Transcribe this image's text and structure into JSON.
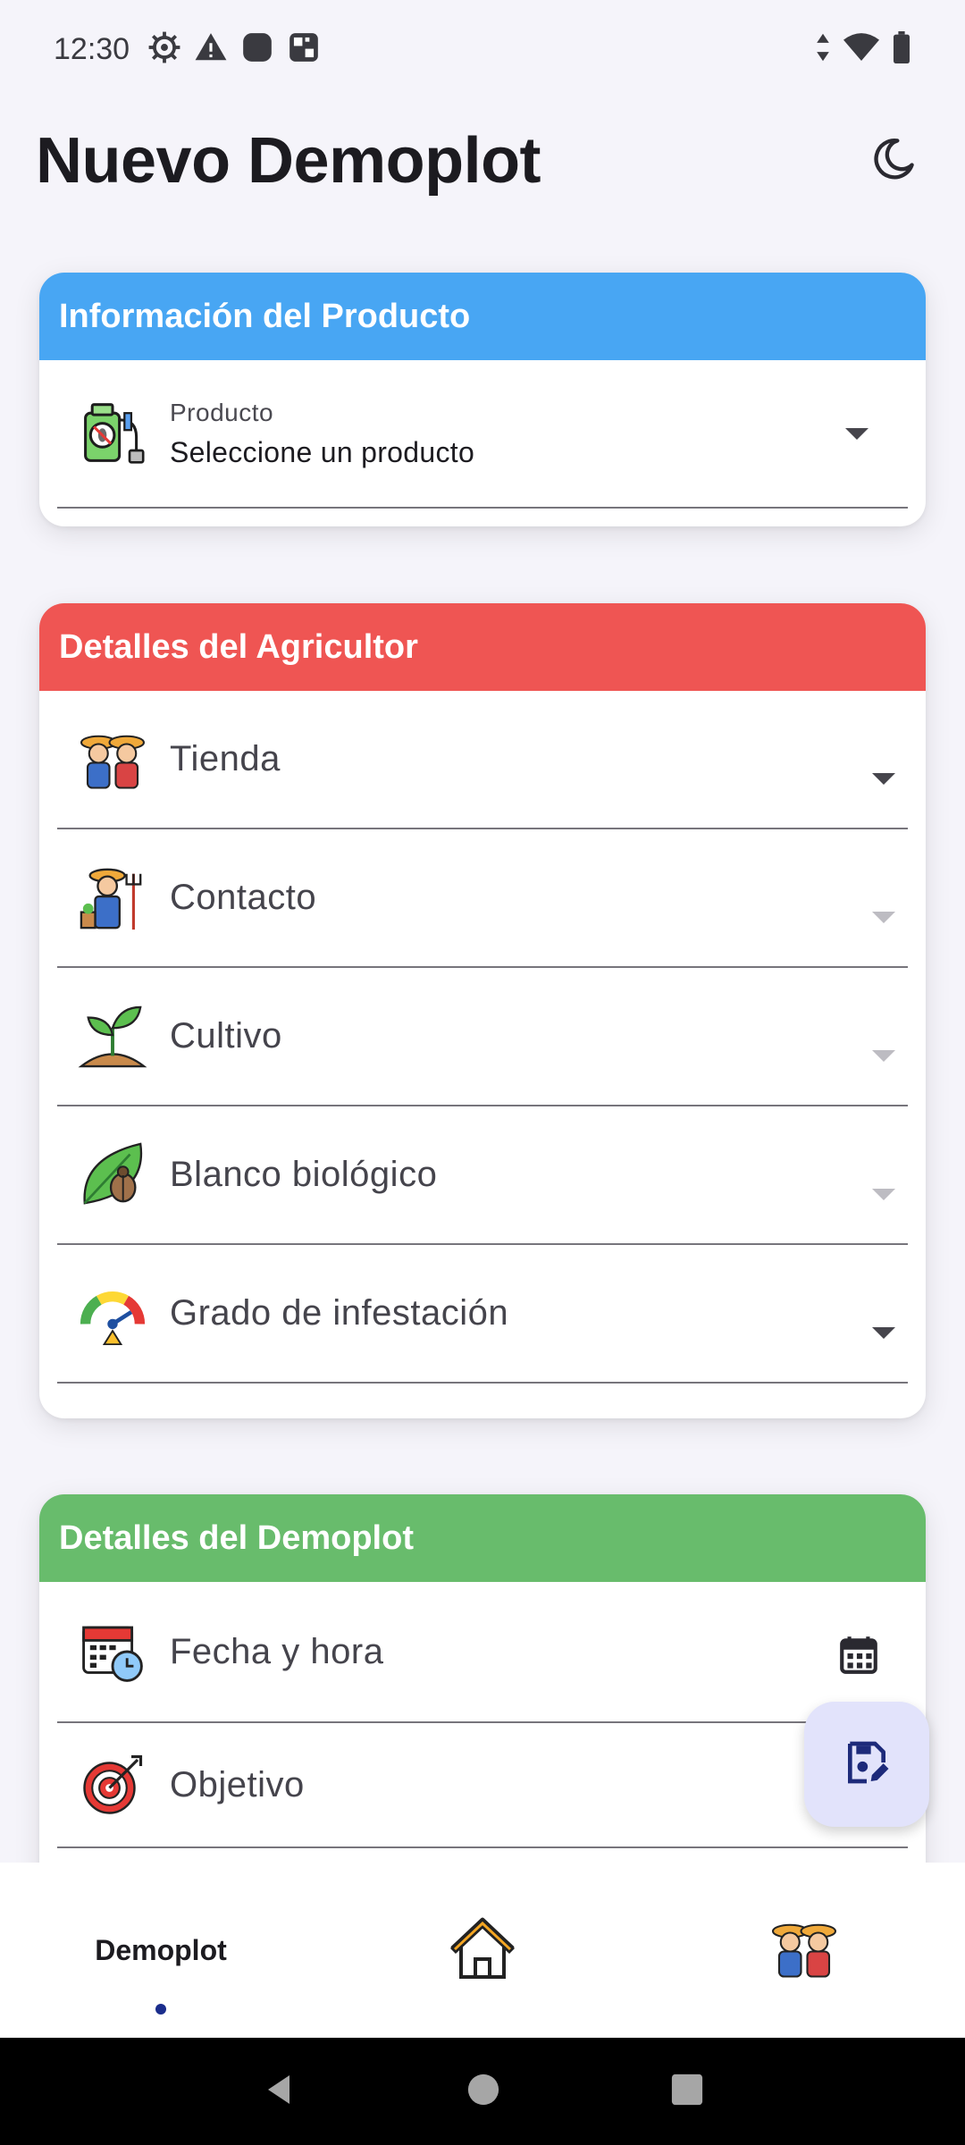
{
  "status_bar": {
    "time": "12:30",
    "left_icons": [
      "settings-icon",
      "warning-icon",
      "app-icon",
      "app-grid-icon"
    ],
    "right_icons": [
      "data-arrows-icon",
      "wifi-icon",
      "battery-icon"
    ]
  },
  "header": {
    "title": "Nuevo Demoplot",
    "theme_icon": "moon-icon"
  },
  "product_section": {
    "title": "Información del Producto",
    "color": "#48a6f3",
    "field": {
      "icon": "sprayer-icon",
      "label": "Producto",
      "value": "Seleccione un producto"
    }
  },
  "farmer_section": {
    "title": "Detalles del Agricultor",
    "color": "#ef5553",
    "fields": [
      {
        "label": "Tienda",
        "icon": "farmers-icon",
        "enabled": true
      },
      {
        "label": "Contacto",
        "icon": "farmer-icon",
        "enabled": false
      },
      {
        "label": "Cultivo",
        "icon": "sprout-icon",
        "enabled": false
      },
      {
        "label": "Blanco biológico",
        "icon": "pest-leaf-icon",
        "enabled": false
      },
      {
        "label": "Grado de infestación",
        "icon": "gauge-icon",
        "enabled": true
      }
    ]
  },
  "demoplot_section": {
    "title": "Detalles del Demoplot",
    "color": "#68bc6c",
    "fields": [
      {
        "label": "Fecha y hora",
        "icon": "calendar-clock-icon",
        "trailing_icon": "calendar-icon"
      },
      {
        "label": "Objetivo",
        "icon": "target-icon"
      }
    ]
  },
  "fab": {
    "icon": "save-edit-icon"
  },
  "bottom_nav": {
    "items": [
      {
        "label": "Demoplot",
        "active": true
      },
      {
        "icon": "home-icon"
      },
      {
        "icon": "farmers-icon"
      }
    ]
  },
  "system_nav": [
    "back-icon",
    "home-circle-icon",
    "recents-icon"
  ]
}
